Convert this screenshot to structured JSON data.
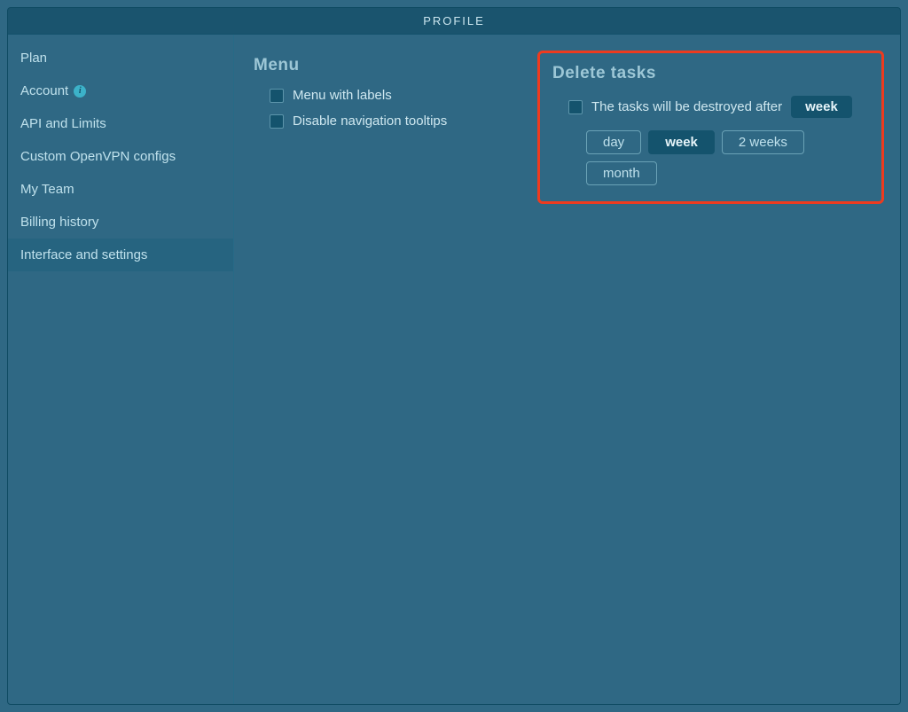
{
  "title": "PROFILE",
  "sidebar": {
    "items": [
      {
        "label": "Plan",
        "active": false,
        "info": false
      },
      {
        "label": "Account",
        "active": false,
        "info": true
      },
      {
        "label": "API and Limits",
        "active": false,
        "info": false
      },
      {
        "label": "Custom OpenVPN configs",
        "active": false,
        "info": false
      },
      {
        "label": "My Team",
        "active": false,
        "info": false
      },
      {
        "label": "Billing history",
        "active": false,
        "info": false
      },
      {
        "label": "Interface and settings",
        "active": true,
        "info": false
      }
    ]
  },
  "menu_section": {
    "title": "Menu",
    "items": [
      {
        "label": "Menu with labels",
        "checked": false
      },
      {
        "label": "Disable navigation tooltips",
        "checked": false
      }
    ]
  },
  "delete_section": {
    "title": "Delete tasks",
    "checkbox_label": "The tasks will be destroyed after",
    "checked": false,
    "selected_value": "week",
    "options": [
      {
        "label": "day",
        "selected": false
      },
      {
        "label": "week",
        "selected": true
      },
      {
        "label": "2 weeks",
        "selected": false
      },
      {
        "label": "month",
        "selected": false
      }
    ]
  },
  "highlight": {
    "color": "#ee3b1f"
  }
}
